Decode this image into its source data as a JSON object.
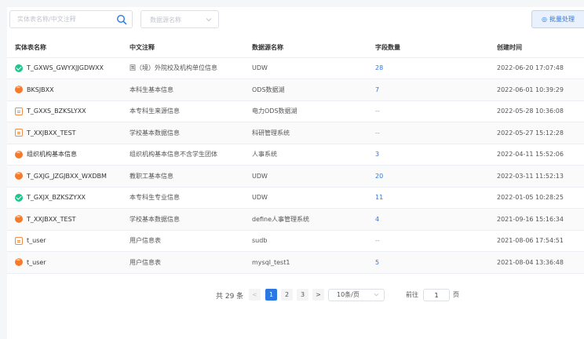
{
  "search": {
    "placeholder": "实体表名称/中文注释"
  },
  "filter": {
    "placeholder": "数据源名称"
  },
  "toolbar": {
    "batch_label": "批量处理"
  },
  "table": {
    "headers": [
      "实体表名称",
      "中文注释",
      "数据源名称",
      "字段数量",
      "创建时间"
    ],
    "rows": [
      {
        "status": "ok",
        "name": "T_GXWS_GWYXJJGDWXX",
        "comment": "国（境）外院校及机构单位信息",
        "source": "UDW",
        "count": "28",
        "created": "2022-06-20 17:07:48"
      },
      {
        "status": "err",
        "name": "BKSJBXX",
        "comment": "本科生基本信息",
        "source": "ODS数据湖",
        "count": "7",
        "created": "2022-06-01 10:39:29"
      },
      {
        "status": "db",
        "name": "T_GXXS_BZKSLYXX",
        "comment": "本专科生来源信息",
        "source": "电力ODS数据湖",
        "count": "--",
        "created": "2022-05-28 10:36:08"
      },
      {
        "status": "db",
        "name": "T_XXJBXX_TEST",
        "comment": "学校基本数据信息",
        "source": "科研管理系统",
        "count": "--",
        "created": "2022-05-27 15:12:28"
      },
      {
        "status": "err",
        "name": "组织机构基本信息",
        "comment": "组织机构基本信息不含学生团体",
        "source": "人事系统",
        "count": "3",
        "created": "2022-04-11 15:52:06"
      },
      {
        "status": "err",
        "name": "T_GXJG_JZGJBXX_WXDBM",
        "comment": "教职工基本信息",
        "source": "UDW",
        "count": "20",
        "created": "2022-03-11 11:52:13"
      },
      {
        "status": "ok",
        "name": "T_GXJX_BZKSZYXX",
        "comment": "本专科生专业信息",
        "source": "UDW",
        "count": "11",
        "created": "2022-01-05 10:28:25"
      },
      {
        "status": "err",
        "name": "T_XXJBXX_TEST",
        "comment": "学校基本数据信息",
        "source": "define人事管理系统",
        "count": "4",
        "created": "2021-09-16 15:16:34"
      },
      {
        "status": "db",
        "name": "t_user",
        "comment": "用户信息表",
        "source": "sudb",
        "count": "--",
        "created": "2021-08-06 17:54:51"
      },
      {
        "status": "err",
        "name": "t_user",
        "comment": "用户信息表",
        "source": "mysql_test1",
        "count": "5",
        "created": "2021-08-04 13:36:48"
      }
    ]
  },
  "pagination": {
    "total": "共 29 条",
    "pages": [
      "1",
      "2",
      "3"
    ],
    "current": "1",
    "page_size": "10条/页",
    "goto_label": "前往",
    "goto_value": "1",
    "page_unit": "页"
  },
  "colors": {
    "accent": "#2b78e4",
    "ok": "#1cc68e",
    "err": "#f57b2c"
  }
}
